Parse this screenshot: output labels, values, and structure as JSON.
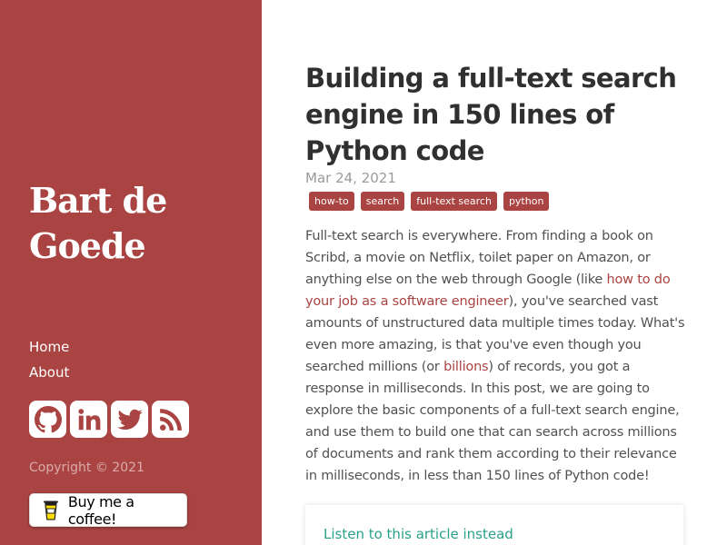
{
  "sidebar": {
    "site_title_line1": "Bart de",
    "site_title_line2": "Goede",
    "nav": [
      {
        "label": "Home"
      },
      {
        "label": "About"
      }
    ],
    "socials": [
      {
        "icon": "github-icon"
      },
      {
        "icon": "linkedin-icon"
      },
      {
        "icon": "twitter-icon"
      },
      {
        "icon": "rss-icon"
      }
    ],
    "copyright": "Copyright © 2021",
    "coffee_button": "Buy me a coffee!",
    "background_color": "#a94442"
  },
  "post": {
    "title": "Building a full-text search engine in 150 lines of Python code",
    "date": "Mar 24, 2021",
    "tags": [
      "how-to",
      "search",
      "full-text search",
      "python"
    ],
    "body": {
      "part1": "Full-text search is everywhere. From finding a book on Scribd, a movie on Netflix, toilet paper on Amazon, or anything else on the web through Google (like ",
      "link1": "how to do your job as a software engineer",
      "part2": "), you've searched vast amounts of unstructured data multiple times today. What's even more amazing, is that you've even though you searched millions (or ",
      "link2": "billions",
      "part3": ") of records, you got a response in milliseconds. In this post, we are going to explore the basic components of a full-text search engine, and use them to build one that can search across millions of documents and rank them according to their relevance in milliseconds, in less than 150 lines of Python code!"
    },
    "audio_link": "Listen to this article instead",
    "accent_color": "#a94442",
    "audio_link_color": "#2aa18a"
  }
}
